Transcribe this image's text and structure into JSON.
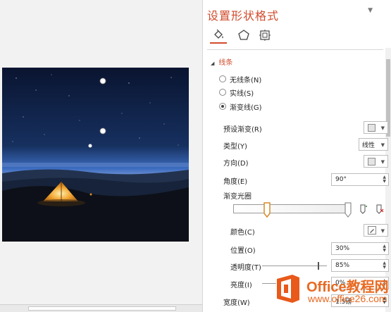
{
  "pane": {
    "title": "设置形状格式",
    "menu_arrow": "▼",
    "tabs": [
      {
        "name": "fill-and-line",
        "icon": "paint-bucket-icon",
        "active": true
      },
      {
        "name": "effects",
        "icon": "pentagon-icon"
      },
      {
        "name": "size-and-properties",
        "icon": "size-properties-icon"
      }
    ]
  },
  "line_section": {
    "title": "线条",
    "options": [
      {
        "label": "无线条(N)",
        "selected": false
      },
      {
        "label": "实线(S)",
        "selected": false
      },
      {
        "label": "渐变线(G)",
        "selected": true
      }
    ]
  },
  "gradient": {
    "preset_label": "预设渐变(R)",
    "type_label": "类型(Y)",
    "type_value": "线性",
    "direction_label": "方向(D)",
    "angle_label": "角度(E)",
    "angle_value": "90°",
    "stops_label": "渐变光圈",
    "color_label": "颜色(C)",
    "position_label": "位置(O)",
    "position_value": "30%",
    "transparency_label": "透明度(T)",
    "transparency_value": "85%",
    "transparency_level": 0.85,
    "brightness_label": "亮度(I)",
    "brightness_value": "0%",
    "width_label": "宽度(W)",
    "width_value": "1.5磅"
  },
  "watermark": {
    "line1": "Office教程网",
    "line2": "www.office26.com"
  },
  "colors": {
    "accent": "#d04b2c",
    "sky_top": "#0b1632",
    "sky_horizon": "#2d58a8",
    "tent": "#f5b23a"
  }
}
